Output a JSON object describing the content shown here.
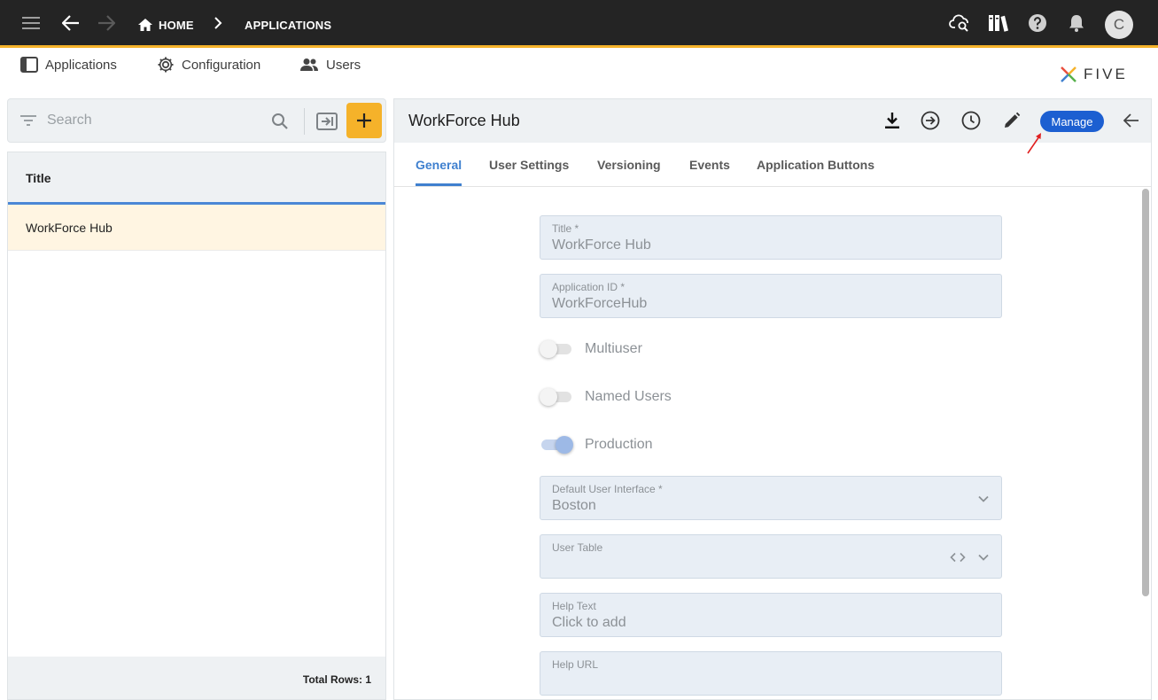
{
  "topbar": {
    "crumbs": [
      "HOME",
      "APPLICATIONS"
    ],
    "avatar_initial": "C",
    "accent_color": "#f5b22a",
    "icons": [
      "menu-icon",
      "back-icon",
      "forward-icon",
      "home-icon",
      "chevron-right-icon",
      "cloud-search-icon",
      "library-icon",
      "help-icon",
      "bell-icon"
    ]
  },
  "subnav": {
    "items": [
      "Applications",
      "Configuration",
      "Users"
    ],
    "logo_text": "FIVE"
  },
  "search": {
    "placeholder": "Search"
  },
  "list": {
    "header": "Title",
    "rows": [
      "WorkForce Hub"
    ],
    "footer": "Total Rows: 1"
  },
  "detail": {
    "title": "WorkForce Hub",
    "manage_label": "Manage",
    "tabs": [
      "General",
      "User Settings",
      "Versioning",
      "Events",
      "Application Buttons"
    ],
    "active_tab": "General",
    "fields": {
      "title": {
        "label": "Title *",
        "value": "WorkForce Hub"
      },
      "application_id": {
        "label": "Application ID *",
        "value": "WorkForceHub"
      },
      "default_ui": {
        "label": "Default User Interface *",
        "value": "Boston"
      },
      "user_table": {
        "label": "User Table",
        "value": ""
      },
      "help_text": {
        "label": "Help Text",
        "value": "Click to add"
      },
      "help_url": {
        "label": "Help URL",
        "value": ""
      }
    },
    "toggles": {
      "multiuser": {
        "label": "Multiuser",
        "on": false
      },
      "named_users": {
        "label": "Named Users",
        "on": false
      },
      "production": {
        "label": "Production",
        "on": true
      }
    }
  }
}
